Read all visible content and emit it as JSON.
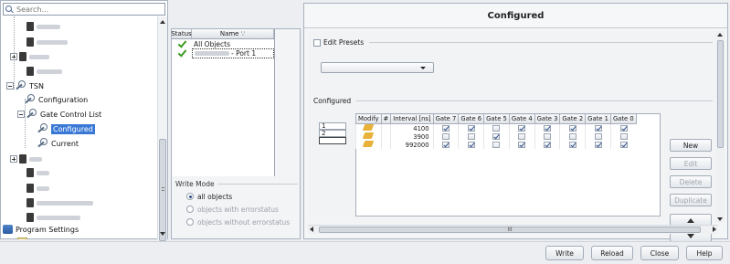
{
  "search": {
    "placeholder": "Search..."
  },
  "tree": {
    "tsn_label": "TSN",
    "configuration_label": "Configuration",
    "gate_control_list_label": "Gate Control List",
    "configured_label": "Configured",
    "current_label": "Current",
    "program_settings_label": "Program Settings"
  },
  "status_table": {
    "headers": [
      "Status",
      "Name ∵"
    ],
    "rows": [
      {
        "name": "All Objects"
      },
      {
        "name": "- Port 1"
      }
    ]
  },
  "write_mode": {
    "title": "Write Mode",
    "options": [
      "all objects",
      "objects with errorstatus",
      "objects without errorstatus"
    ]
  },
  "main": {
    "title": "Configured",
    "edit_presets_label": "Edit Presets",
    "configured_section_label": "Configured",
    "row_indices": [
      "1",
      "2",
      "3"
    ],
    "columns": [
      "Modify",
      "#",
      "Interval [ns]",
      "Gate 7",
      "Gate 6",
      "Gate 5",
      "Gate 4",
      "Gate 3",
      "Gate 2",
      "Gate 1",
      "Gate 0"
    ],
    "rows": [
      {
        "interval": "4100",
        "gates": [
          true,
          true,
          false,
          true,
          true,
          true,
          true,
          true
        ]
      },
      {
        "interval": "3900",
        "gates": [
          false,
          false,
          true,
          false,
          false,
          false,
          false,
          false
        ]
      },
      {
        "interval": "992000",
        "gates": [
          true,
          true,
          false,
          true,
          true,
          true,
          true,
          true
        ]
      }
    ],
    "side_buttons": {
      "new": "New",
      "edit": "Edit",
      "delete": "Delete",
      "duplicate": "Duplicate"
    },
    "hscroll_grip": "III"
  },
  "bottom_buttons": {
    "write": "Write",
    "reload": "Reload",
    "close": "Close",
    "help": "Help"
  },
  "colors": {
    "selection": "#3a78d6",
    "check": "#3a9a1f",
    "accent": "#2d4f8a"
  }
}
